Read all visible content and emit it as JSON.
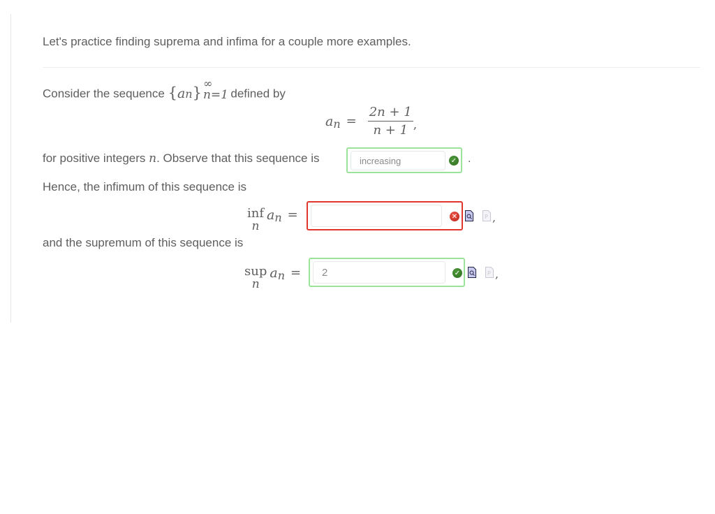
{
  "intro": "Let's practice finding suprema and infima for a couple more examples.",
  "p1": {
    "before": "Consider the sequence",
    "seq_open": "{",
    "seq_var": "a",
    "seq_sub": "n",
    "seq_close": "}",
    "seq_sup": "∞",
    "seq_lower": "n=1",
    "after": "defined by"
  },
  "formula": {
    "lhs_var": "a",
    "lhs_sub": "n",
    "eq": "=",
    "numerator": "2n + 1",
    "denominator": "n + 1",
    "trail": ","
  },
  "p2": {
    "before": "for positive integers",
    "var": "n",
    "after": ". Observe that this sequence is",
    "trail": "."
  },
  "monotonic_answer": {
    "value": "increasing",
    "status": "correct"
  },
  "p3": {
    "text": "Hence, the infimum of this sequence is"
  },
  "inf_eq": {
    "op": "inf",
    "under": "n",
    "var": "a",
    "sub": "n",
    "eq": "=",
    "trail": ","
  },
  "inf_answer": {
    "value": "",
    "status": "incorrect"
  },
  "p4": {
    "text": "and the supremum of this sequence is"
  },
  "sup_eq": {
    "op": "sup",
    "under": "n",
    "var": "a",
    "sub": "n",
    "eq": "=",
    "trail": ","
  },
  "sup_answer": {
    "value": "2",
    "status": "correct"
  },
  "icons": {
    "correct": "check-circle-icon",
    "incorrect": "x-circle-icon",
    "preview": "preview-document-icon",
    "palette": "formula-palette-icon"
  },
  "colors": {
    "correct_border": "#9be39b",
    "incorrect_border": "#e0362c",
    "correct_icon": "#2e6b1f",
    "incorrect_icon": "#b51f16",
    "text": "#5e5e5e"
  }
}
